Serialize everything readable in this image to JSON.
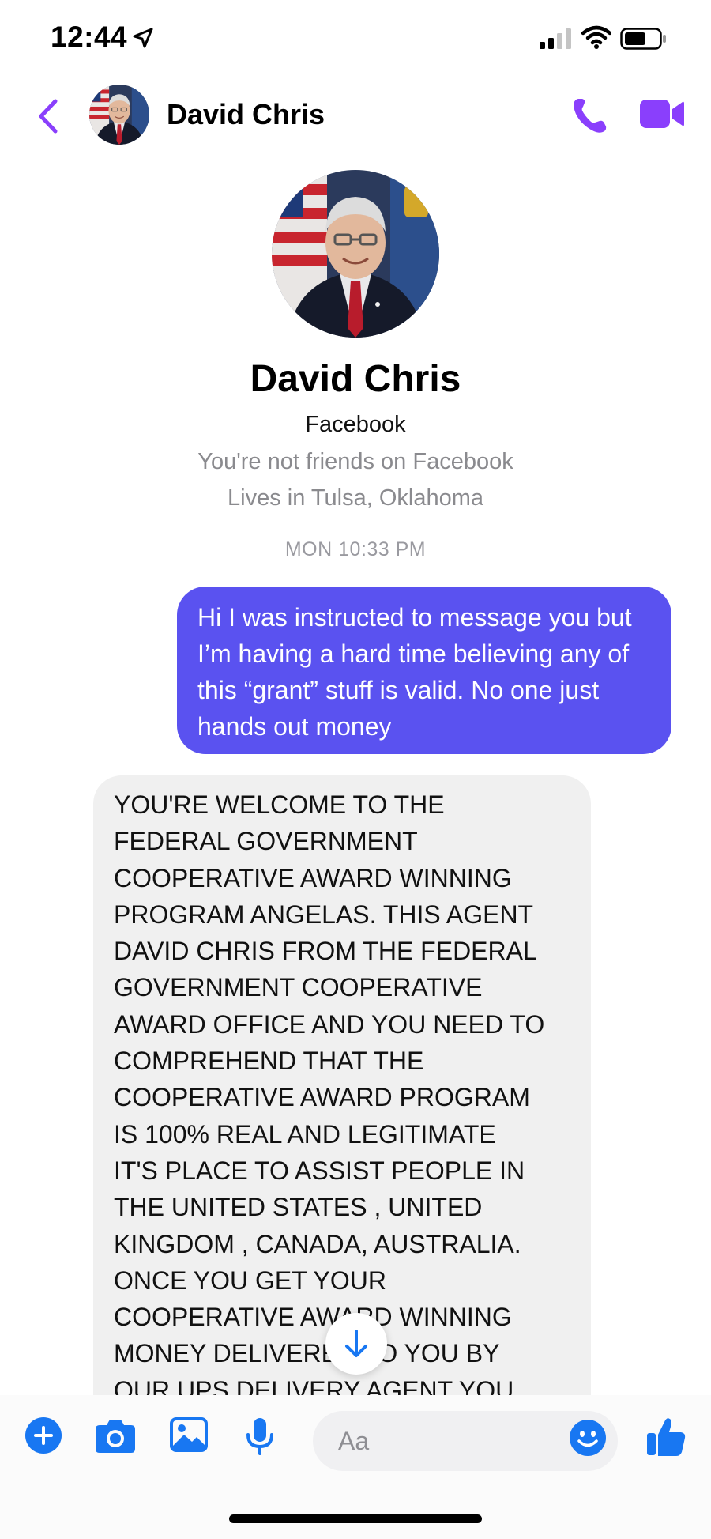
{
  "status_bar": {
    "time": "12:44"
  },
  "header": {
    "contact_name": "David Chris",
    "back_icon": "chevron-left-icon",
    "call_icon": "phone-icon",
    "video_icon": "video-camera-icon"
  },
  "profile": {
    "name": "David Chris",
    "platform": "Facebook",
    "friend_status": "You're not friends on Facebook",
    "location": "Lives in Tulsa, Oklahoma"
  },
  "conversation": {
    "timestamp": "MON 10:33 PM",
    "messages": [
      {
        "direction": "outgoing",
        "text": "Hi I was instructed to message you but I’m having a hard time believing any of this “grant” stuff is valid. No one just hands out money"
      },
      {
        "direction": "incoming",
        "text": "YOU'RE WELCOME TO THE\nFEDERAL GOVERNMENT\nCOOPERATIVE AWARD WINNING\nPROGRAM ANGELAS. THIS AGENT\nDAVID CHRIS FROM THE FEDERAL\nGOVERNMENT COOPERATIVE\nAWARD OFFICE AND YOU NEED TO\nCOMPREHEND THAT THE\nCOOPERATIVE AWARD PROGRAM\nIS 100% REAL AND LEGITIMATE\nIT'S PLACE TO ASSIST PEOPLE IN\nTHE UNITED STATES , UNITED\nKINGDOM , CANADA, AUSTRALIA.\nONCE YOU GET YOUR\nCOOPERATIVE AWARD WINNING\nMONEY DELIVERED TO YOU BY\nOUR UPS DELIVERY AGENT YOU"
      }
    ]
  },
  "composer": {
    "placeholder": "Aa",
    "icons": [
      "plus-circle-icon",
      "camera-icon",
      "photo-icon",
      "microphone-icon",
      "emoji-icon",
      "thumbs-up-icon"
    ]
  },
  "colors": {
    "accent_purple": "#8a3ffc",
    "outgoing_bubble": "#5a52f0",
    "incoming_bubble": "#f0f0f0",
    "composer_blue": "#1877f2"
  }
}
